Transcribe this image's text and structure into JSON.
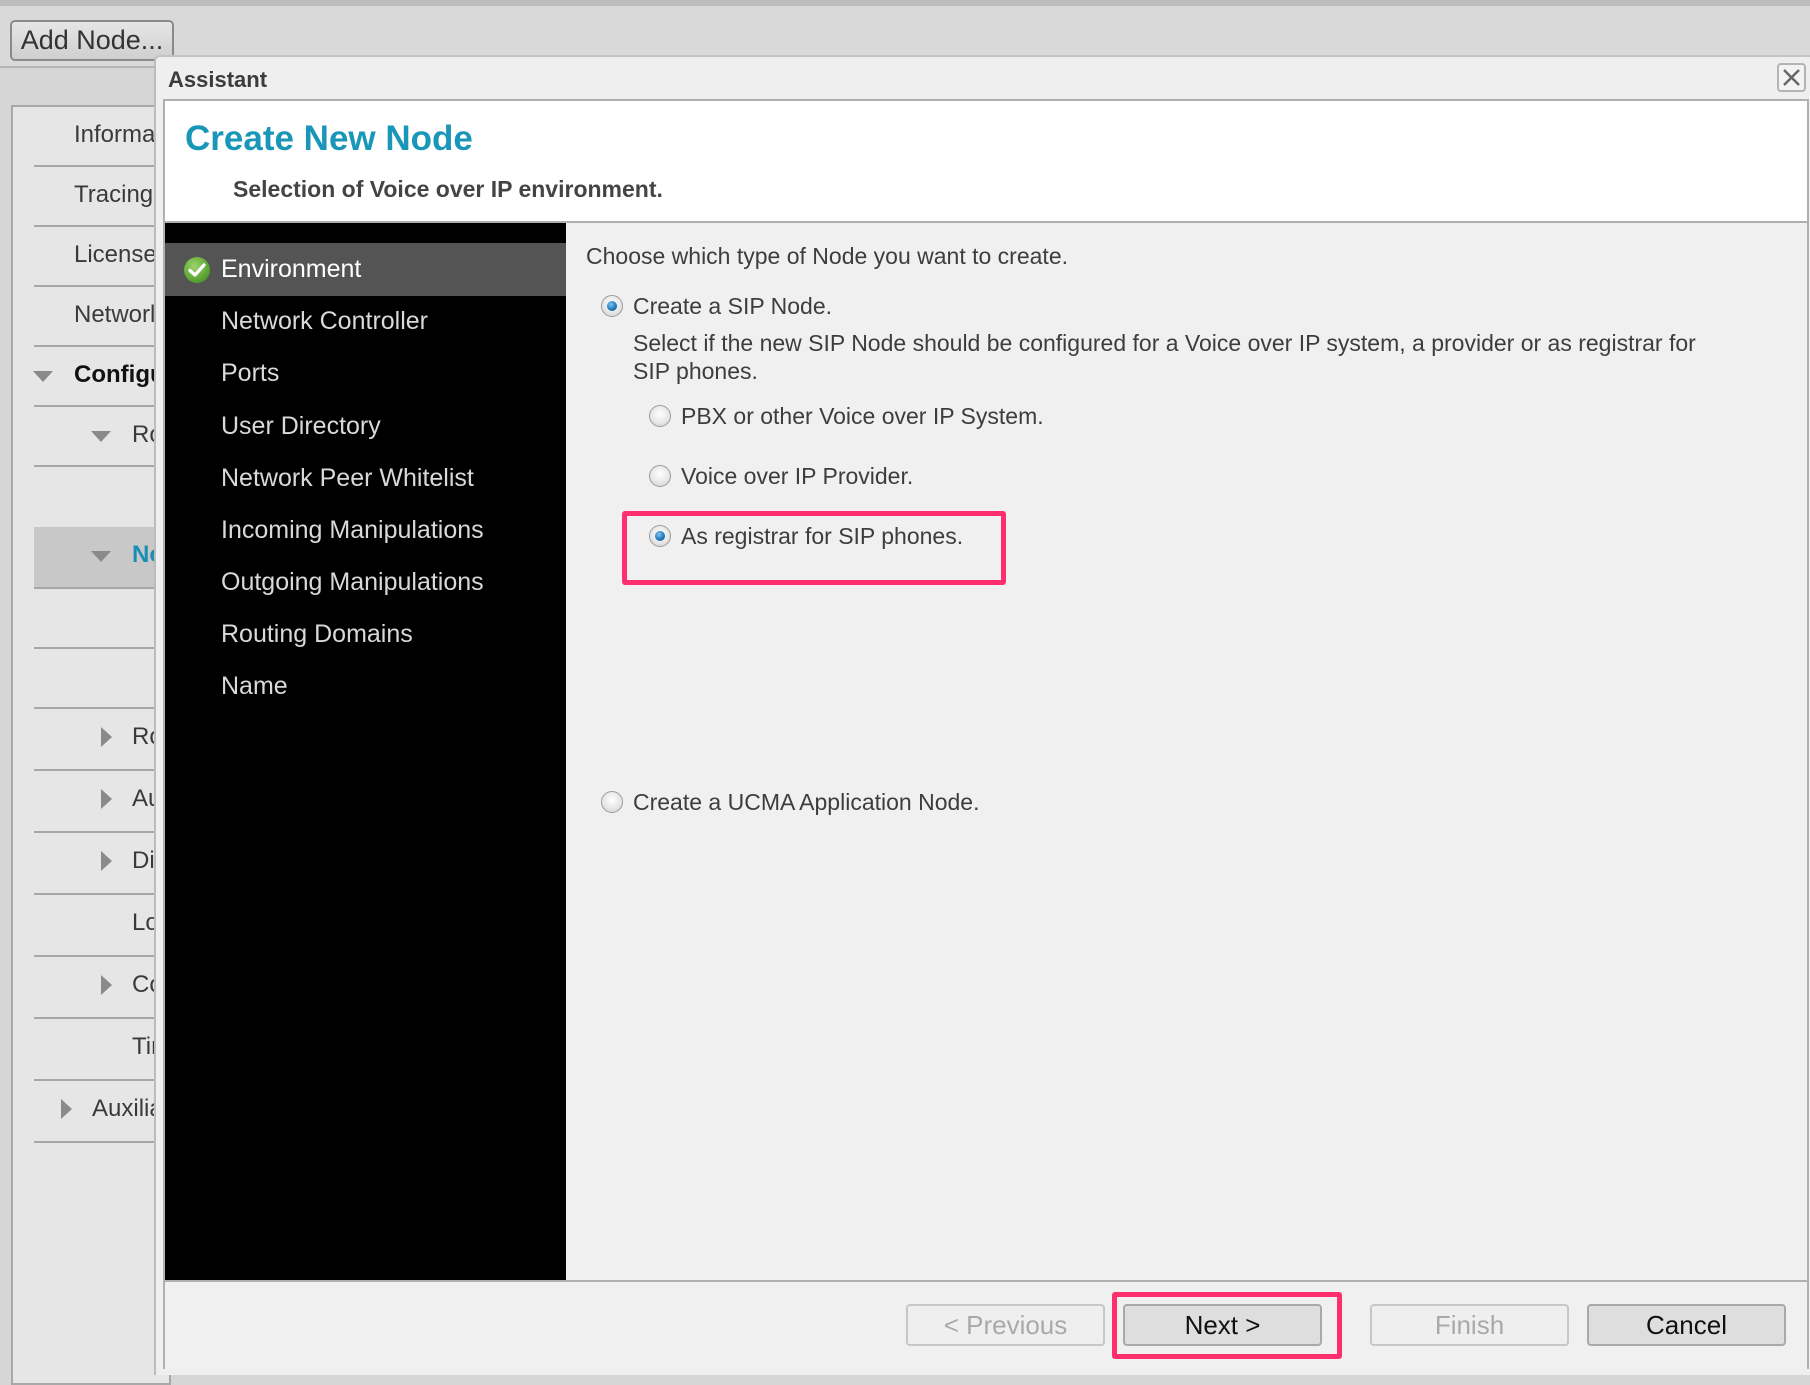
{
  "toolbar": {
    "add_node_label": "Add Node..."
  },
  "left_nav": {
    "items": [
      {
        "label": "Informa",
        "icon": null
      },
      {
        "label": "Tracing",
        "icon": null
      },
      {
        "label": "License",
        "icon": null
      },
      {
        "label": "Networl",
        "icon": null
      },
      {
        "label": "Configu",
        "icon": "triangle-down-icon",
        "style": "bold"
      },
      {
        "label": "Rou",
        "icon": "triangle-down-icon"
      },
      {
        "label": "",
        "icon": null
      },
      {
        "label": "Noc",
        "icon": "triangle-down-icon",
        "style": "selected"
      },
      {
        "label": "",
        "icon": null
      },
      {
        "label": "",
        "icon": null
      },
      {
        "label": "Rou",
        "icon": "triangle-right-icon"
      },
      {
        "label": "Autl",
        "icon": "triangle-right-icon"
      },
      {
        "label": "Dire",
        "icon": "triangle-right-icon"
      },
      {
        "label": "Loa",
        "icon": null
      },
      {
        "label": "Cor",
        "icon": "triangle-right-icon"
      },
      {
        "label": "Tim",
        "icon": null
      },
      {
        "label": "Auxiliar",
        "icon": "triangle-right-icon"
      }
    ]
  },
  "dialog": {
    "title": "Assistant",
    "close_icon": "close-x-icon",
    "header": {
      "title": "Create New Node",
      "subtitle": "Selection of Voice over IP environment."
    },
    "steps": [
      {
        "label": "Environment",
        "active": true,
        "completed": true
      },
      {
        "label": "Network Controller"
      },
      {
        "label": "Ports"
      },
      {
        "label": "User Directory"
      },
      {
        "label": "Network Peer Whitelist"
      },
      {
        "label": "Incoming Manipulations"
      },
      {
        "label": "Outgoing Manipulations"
      },
      {
        "label": "Routing Domains"
      },
      {
        "label": "Name"
      }
    ],
    "content": {
      "prompt": "Choose which type of Node you want to create.",
      "sip_option": {
        "label": "Create a SIP Node.",
        "selected": true,
        "description_line1": "Select if the new SIP Node should be configured for a Voice over IP system, a provider or as registrar for",
        "description_line2": "SIP phones.",
        "sub_options": [
          {
            "label": "PBX or other Voice over IP System.",
            "selected": false
          },
          {
            "label": "Voice over IP Provider.",
            "selected": false
          },
          {
            "label": "As registrar for SIP phones.",
            "selected": true,
            "highlighted": true
          }
        ]
      },
      "ucma_option": {
        "label": "Create a UCMA Application Node.",
        "selected": false
      }
    },
    "buttons": {
      "previous": {
        "label": "< Previous",
        "enabled": false
      },
      "next": {
        "label": "Next >",
        "enabled": true,
        "highlighted": true
      },
      "finish": {
        "label": "Finish",
        "enabled": false
      },
      "cancel": {
        "label": "Cancel",
        "enabled": true
      }
    },
    "colors": {
      "accent": "#1a96b8",
      "highlight": "#ff2f6e",
      "check_green": "#6db33f"
    }
  }
}
